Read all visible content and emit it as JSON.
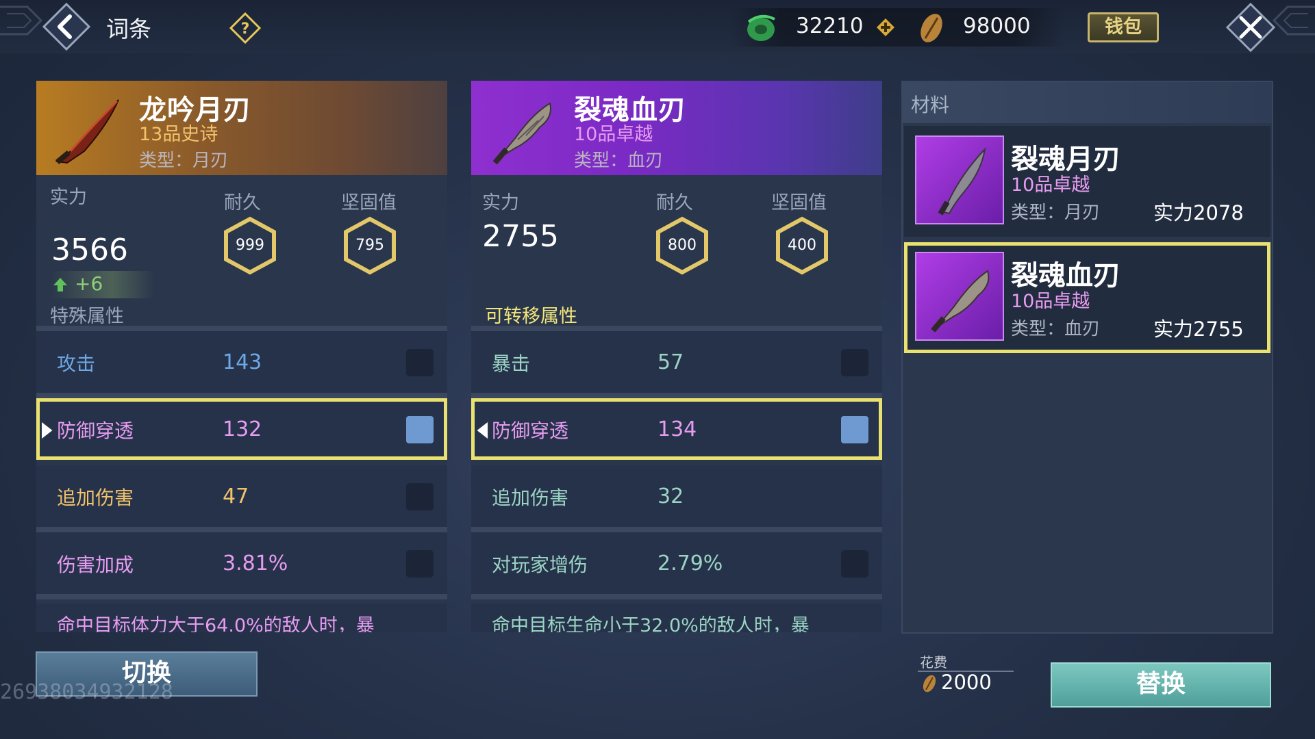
{
  "header": {
    "title": "词条",
    "currency_jade": "32210",
    "currency_shell": "98000",
    "wallet_label": "钱包"
  },
  "left_item": {
    "name": "龙吟月刃",
    "grade": "13品史诗",
    "type": "类型：月刃",
    "power_label": "实力",
    "power": "3566",
    "power_diff": "+6",
    "durability_label": "耐久",
    "durability": "999",
    "solidity_label": "坚固值",
    "solidity": "795",
    "section_title": "特殊属性",
    "attributes": [
      {
        "name": "攻击",
        "value": "143",
        "name_color": "#6ea7e6",
        "value_color": "#6ea7e6"
      },
      {
        "name": "防御穿透",
        "value": "132",
        "name_color": "#e79cf0",
        "value_color": "#e79cf0"
      },
      {
        "name": "追加伤害",
        "value": "47",
        "name_color": "#f3c36b",
        "value_color": "#f3c36b"
      },
      {
        "name": "伤害加成",
        "value": "3.81%",
        "name_color": "#e79cf0",
        "value_color": "#e79cf0"
      }
    ],
    "truncated": "命中目标体力大于64.0%的敌人时，暴"
  },
  "mid_item": {
    "name": "裂魂血刃",
    "grade": "10品卓越",
    "type": "类型：血刃",
    "power_label": "实力",
    "power": "2755",
    "durability_label": "耐久",
    "durability": "800",
    "solidity_label": "坚固值",
    "solidity": "400",
    "section_title": "可转移属性",
    "attributes": [
      {
        "name": "暴击",
        "value": "57",
        "name_color": "#9bd4c4",
        "value_color": "#9bd4c4"
      },
      {
        "name": "防御穿透",
        "value": "134",
        "name_color": "#e79cf0",
        "value_color": "#e79cf0"
      },
      {
        "name": "追加伤害",
        "value": "32",
        "name_color": "#9bd4c4",
        "value_color": "#9bd4c4"
      },
      {
        "name": "对玩家增伤",
        "value": "2.79%",
        "name_color": "#9bd4c4",
        "value_color": "#9bd4c4"
      }
    ],
    "truncated": "命中目标生命小于32.0%的敌人时，暴"
  },
  "materials": {
    "title": "材料",
    "items": [
      {
        "name": "裂魂月刃",
        "grade": "10品卓越",
        "type": "类型：月刃",
        "power": "实力2078"
      },
      {
        "name": "裂魂血刃",
        "grade": "10品卓越",
        "type": "类型：血刃",
        "power": "实力2755"
      }
    ]
  },
  "footer": {
    "switch_label": "切换",
    "watermark": "26938034932128",
    "cost_label": "花费",
    "cost_value": "2000",
    "replace_label": "替换"
  },
  "colors": {
    "highlight": "#e9e271",
    "epic_gold": "#f3c36b",
    "excellent_purple": "#e79cf0",
    "accent_teal": "#4f9f9b"
  }
}
